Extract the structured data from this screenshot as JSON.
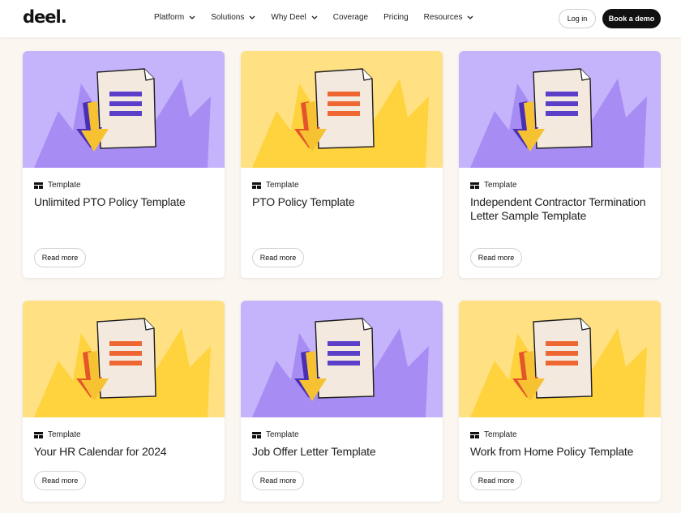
{
  "nav": {
    "logo": "deel.",
    "menu": [
      "Platform",
      "Solutions",
      "Why Deel",
      "Coverage",
      "Pricing",
      "Resources"
    ],
    "menu_has_chevron": [
      true,
      true,
      true,
      false,
      false,
      true
    ],
    "login": "Log in",
    "book_demo": "Book a demo"
  },
  "colors": {
    "purple_bg": "#c5b4fb",
    "purple_shape": "#a68cf3",
    "purple_lines": "#5b3fc9",
    "yellow_bg": "#ffe083",
    "yellow_shape": "#ffd33d",
    "orange_lines": "#ee6732",
    "paper": "#f3e9de"
  },
  "cards": [
    {
      "theme": "purple",
      "tag": "Template",
      "title": "Unlimited PTO Policy Template",
      "cta": "Read more"
    },
    {
      "theme": "yellow",
      "tag": "Template",
      "title": "PTO Policy Template",
      "cta": "Read more"
    },
    {
      "theme": "purple",
      "tag": "Template",
      "title": "Independent Contractor Termination Letter Sample Template",
      "cta": "Read more"
    },
    {
      "theme": "yellow",
      "tag": "Template",
      "title": "Your HR Calendar for 2024",
      "cta": "Read more"
    },
    {
      "theme": "purple",
      "tag": "Template",
      "title": "Job Offer Letter Template",
      "cta": "Read more"
    },
    {
      "theme": "yellow",
      "tag": "Template",
      "title": "Work from Home Policy Template",
      "cta": "Read more"
    }
  ]
}
